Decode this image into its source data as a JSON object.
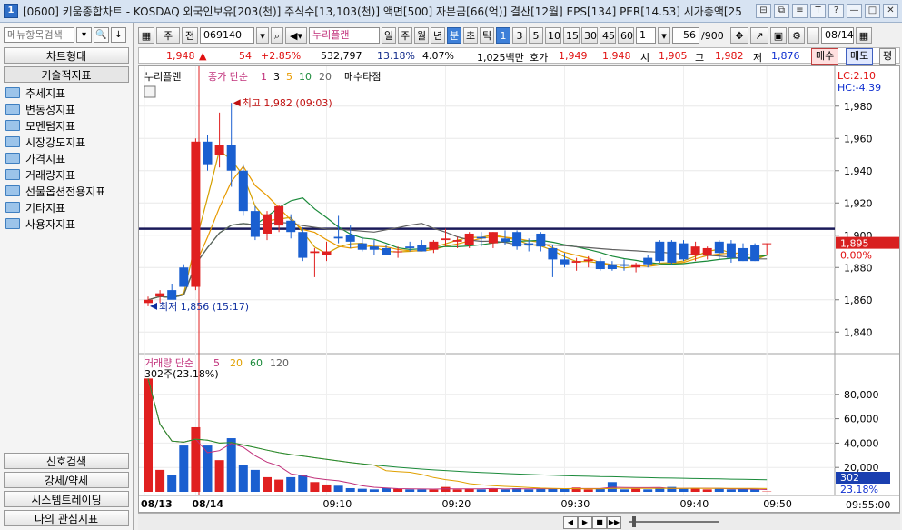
{
  "window": {
    "icon_label": "1",
    "title": "[0600] 키움종합차트 - KOSDAQ 외국인보유[203(천)] 주식수[13,103(천)] 액면[500] 자본금[66(억)] 결산[12월] EPS[134] PER[14.53] 시가총액[25",
    "title_buttons": [
      "⊟",
      "⧉",
      "≡",
      "T",
      "?",
      "—",
      "□",
      "✕"
    ]
  },
  "sidebar": {
    "search_placeholder": "메뉴항목검색",
    "search_buttons": [
      "▾",
      "🔍",
      "↓"
    ],
    "top_button": "차트형태",
    "section_header": "기술적지표",
    "tree_items": [
      "추세지표",
      "변동성지표",
      "모멘텀지표",
      "시장강도지표",
      "가격지표",
      "거래량지표",
      "선물옵션전용지표",
      "기타지표",
      "사용자지표"
    ],
    "bottom_buttons": [
      "신호검색",
      "강세/약세",
      "시스템트레이딩",
      "나의 관심지표"
    ]
  },
  "toolbar": {
    "market": "주",
    "prev": "전",
    "code": "069140",
    "stock_name": "누리플랜",
    "periods": [
      "일",
      "주",
      "월",
      "년",
      "분",
      "초",
      "틱"
    ],
    "active_period": "분",
    "intervals": [
      "1",
      "3",
      "5",
      "10",
      "15",
      "30",
      "45",
      "60"
    ],
    "active_interval": "1",
    "unit": "1",
    "count": "56",
    "count_total": "/900",
    "date": "08/14"
  },
  "quote": {
    "price": "1,948",
    "arrow": "▲",
    "change": "54",
    "change_pct": "+2.85%",
    "volume": "532,797",
    "vol_pct": "13.18%",
    "rate": "4.07%",
    "amount": "1,025백만",
    "ask_label": "호가",
    "ask1": "1,949",
    "ask2": "1,948",
    "open_label": "시",
    "open": "1,905",
    "high_label": "고",
    "high": "1,982",
    "low_label": "저",
    "low": "1,876",
    "buy_label": "매수",
    "sell_label": "매도",
    "eval_label": "평"
  },
  "price_panel": {
    "legend_name": "누리플랜",
    "legend_ma": "종가 단순",
    "ma_periods": [
      "1",
      "3",
      "5",
      "10",
      "20"
    ],
    "legend_extra": "매수타점",
    "lc_label": "LC:2.10",
    "hc_label": "HC:-4.39",
    "high_note": "최고 1,982 (09:03)",
    "low_note": "최저 1,856 (15:17)",
    "current_price": "1,895",
    "current_pct": "0.00%",
    "y_ticks": [
      "1,980",
      "1,960",
      "1,940",
      "1,920",
      "1,900",
      "1,880",
      "1,860",
      "1,840"
    ],
    "ma_colors": {
      "ma3": "#d4a000",
      "ma5": "#e89a00",
      "ma10": "#1a8a3a",
      "ma20": "#606060"
    }
  },
  "volume_panel": {
    "legend": "거래량 단순",
    "ma_periods": [
      "5",
      "20",
      "60",
      "120"
    ],
    "note": "302주(23.18%)",
    "current": "302",
    "current_pct": "23.18%",
    "y_ticks": [
      "80,000",
      "60,000",
      "40,000",
      "20,000"
    ]
  },
  "x_axis": {
    "labels": [
      "08/13",
      "08/14",
      "09:10",
      "09:20",
      "09:30",
      "09:40",
      "09:50"
    ],
    "right_time": "09:55:00"
  },
  "chart_data": {
    "type": "candlestick",
    "time_start": "09:00",
    "ylim": [
      1830,
      1990
    ],
    "resistance_line": 1904,
    "candles": [
      {
        "o": 1858,
        "h": 1862,
        "l": 1856,
        "c": 1860
      },
      {
        "o": 1862,
        "h": 1866,
        "l": 1858,
        "c": 1864
      },
      {
        "o": 1866,
        "h": 1870,
        "l": 1862,
        "c": 1860
      },
      {
        "o": 1880,
        "h": 1882,
        "l": 1868,
        "c": 1868
      },
      {
        "o": 1868,
        "h": 1960,
        "l": 1866,
        "c": 1958
      },
      {
        "o": 1958,
        "h": 1962,
        "l": 1940,
        "c": 1944
      },
      {
        "o": 1950,
        "h": 1976,
        "l": 1942,
        "c": 1956
      },
      {
        "o": 1956,
        "h": 1982,
        "l": 1930,
        "c": 1940
      },
      {
        "o": 1940,
        "h": 1944,
        "l": 1912,
        "c": 1915
      },
      {
        "o": 1915,
        "h": 1918,
        "l": 1897,
        "c": 1899
      },
      {
        "o": 1901,
        "h": 1915,
        "l": 1897,
        "c": 1913
      },
      {
        "o": 1906,
        "h": 1919,
        "l": 1902,
        "c": 1918
      },
      {
        "o": 1909,
        "h": 1913,
        "l": 1898,
        "c": 1902
      },
      {
        "o": 1902,
        "h": 1905,
        "l": 1884,
        "c": 1886
      },
      {
        "o": 1889,
        "h": 1892,
        "l": 1874,
        "c": 1890
      },
      {
        "o": 1888,
        "h": 1896,
        "l": 1884,
        "c": 1890
      },
      {
        "o": 1899,
        "h": 1912,
        "l": 1895,
        "c": 1898
      },
      {
        "o": 1900,
        "h": 1906,
        "l": 1892,
        "c": 1896
      },
      {
        "o": 1895,
        "h": 1899,
        "l": 1890,
        "c": 1891
      },
      {
        "o": 1893,
        "h": 1897,
        "l": 1888,
        "c": 1891
      },
      {
        "o": 1892,
        "h": 1894,
        "l": 1888,
        "c": 1888
      },
      {
        "o": 1890,
        "h": 1893,
        "l": 1886,
        "c": 1890
      },
      {
        "o": 1893,
        "h": 1896,
        "l": 1890,
        "c": 1892
      },
      {
        "o": 1894,
        "h": 1897,
        "l": 1890,
        "c": 1890
      },
      {
        "o": 1891,
        "h": 1897,
        "l": 1889,
        "c": 1896
      },
      {
        "o": 1897,
        "h": 1904,
        "l": 1893,
        "c": 1898
      },
      {
        "o": 1896,
        "h": 1899,
        "l": 1892,
        "c": 1897
      },
      {
        "o": 1894,
        "h": 1902,
        "l": 1892,
        "c": 1901
      },
      {
        "o": 1899,
        "h": 1902,
        "l": 1893,
        "c": 1898
      },
      {
        "o": 1895,
        "h": 1902,
        "l": 1892,
        "c": 1902
      },
      {
        "o": 1898,
        "h": 1903,
        "l": 1894,
        "c": 1896
      },
      {
        "o": 1902,
        "h": 1903,
        "l": 1891,
        "c": 1893
      },
      {
        "o": 1895,
        "h": 1898,
        "l": 1890,
        "c": 1894
      },
      {
        "o": 1901,
        "h": 1902,
        "l": 1890,
        "c": 1893
      },
      {
        "o": 1892,
        "h": 1894,
        "l": 1874,
        "c": 1885
      },
      {
        "o": 1885,
        "h": 1889,
        "l": 1880,
        "c": 1882
      },
      {
        "o": 1883,
        "h": 1886,
        "l": 1878,
        "c": 1884
      },
      {
        "o": 1884,
        "h": 1887,
        "l": 1880,
        "c": 1885
      },
      {
        "o": 1884,
        "h": 1886,
        "l": 1878,
        "c": 1879
      },
      {
        "o": 1882,
        "h": 1884,
        "l": 1878,
        "c": 1879
      },
      {
        "o": 1882,
        "h": 1885,
        "l": 1878,
        "c": 1881
      },
      {
        "o": 1880,
        "h": 1883,
        "l": 1877,
        "c": 1882
      },
      {
        "o": 1886,
        "h": 1888,
        "l": 1880,
        "c": 1882
      },
      {
        "o": 1896,
        "h": 1897,
        "l": 1883,
        "c": 1884
      },
      {
        "o": 1896,
        "h": 1897,
        "l": 1882,
        "c": 1883
      },
      {
        "o": 1895,
        "h": 1897,
        "l": 1884,
        "c": 1885
      },
      {
        "o": 1888,
        "h": 1896,
        "l": 1884,
        "c": 1893
      },
      {
        "o": 1888,
        "h": 1893,
        "l": 1885,
        "c": 1892
      },
      {
        "o": 1896,
        "h": 1897,
        "l": 1885,
        "c": 1889
      },
      {
        "o": 1895,
        "h": 1897,
        "l": 1883,
        "c": 1886
      },
      {
        "o": 1892,
        "h": 1895,
        "l": 1884,
        "c": 1884
      },
      {
        "o": 1894,
        "h": 1895,
        "l": 1884,
        "c": 1884
      },
      {
        "o": 1895,
        "h": 1895,
        "l": 1888,
        "c": 1895
      }
    ],
    "volumes": [
      93000,
      18000,
      14000,
      38000,
      53000,
      38000,
      26000,
      44000,
      22000,
      18000,
      12000,
      10000,
      12000,
      14000,
      8000,
      6000,
      5000,
      3000,
      2500,
      2000,
      3000,
      2500,
      2000,
      2000,
      1800,
      4000,
      2000,
      2500,
      2000,
      3000,
      2000,
      3000,
      2000,
      2500,
      3000,
      2500,
      3500,
      2000,
      2500,
      8000,
      2000,
      2500,
      2000,
      3000,
      4000,
      2500,
      3000,
      2000,
      2500,
      2000,
      2500,
      2000,
      302
    ]
  }
}
